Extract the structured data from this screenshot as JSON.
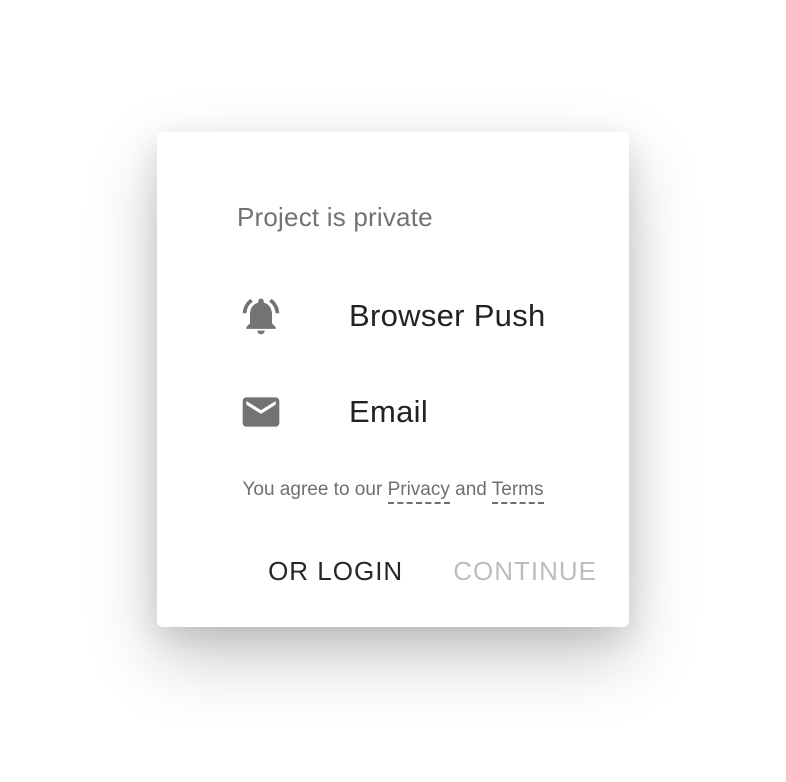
{
  "dialog": {
    "title": "Project is private",
    "options": [
      {
        "label": "Browser Push",
        "icon": "bell-ringing-icon"
      },
      {
        "label": "Email",
        "icon": "mail-icon"
      }
    ],
    "agreement": {
      "prefix": "You agree to our",
      "privacy": "Privacy",
      "conjunction": "and",
      "terms": "Terms"
    },
    "actions": {
      "login": "OR LOGIN",
      "continue": "CONTINUE"
    }
  },
  "colors": {
    "icon": "#737373",
    "title": "#737373",
    "disabled": "#bdbdbd"
  }
}
